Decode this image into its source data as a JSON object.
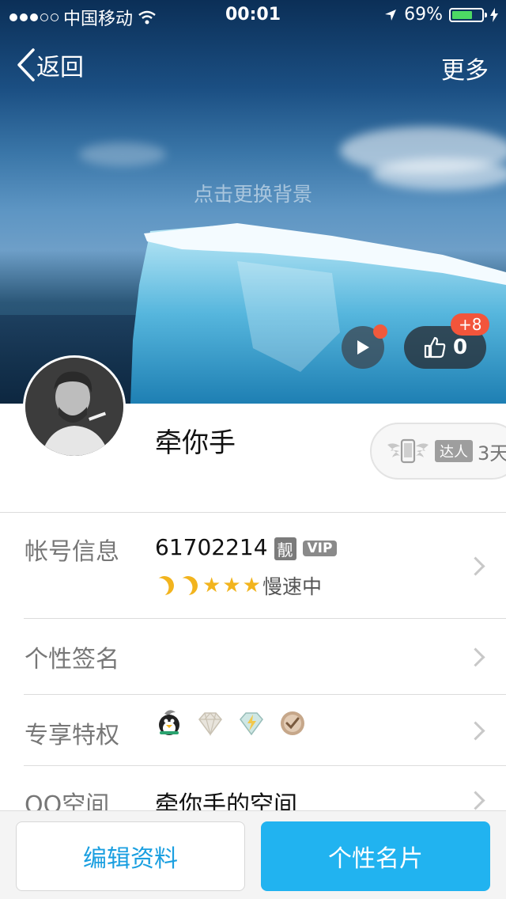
{
  "status_bar": {
    "carrier": "中国移动",
    "time": "00:01",
    "battery": "69%",
    "battery_level": 0.69
  },
  "nav": {
    "back_label": "返回",
    "more_label": "更多"
  },
  "cover": {
    "hint": "点击更换背景",
    "like_count": "0",
    "like_delta": "+8"
  },
  "profile": {
    "nickname": "牵你手",
    "daren_label": "达人",
    "daren_days": "3天"
  },
  "rows": {
    "account": {
      "label": "帐号信息",
      "qq_number": "61702214",
      "liang_badge": "靓",
      "vip_badge": "VIP",
      "level_status": "慢速中"
    },
    "signature": {
      "label": "个性签名"
    },
    "privileges": {
      "label": "专享特权",
      "icons": [
        "penguin-icon",
        "diamond-icon",
        "lightning-diamond-icon",
        "check-badge-icon"
      ]
    },
    "qzone": {
      "label": "QQ空间",
      "value": "牵你手的空间"
    }
  },
  "bottom": {
    "edit_label": "编辑资料",
    "card_label": "个性名片"
  },
  "colors": {
    "accent_blue": "#21b3f0",
    "link_blue": "#1a9fe0",
    "badge_red": "#f2553b",
    "star_gold": "#f2b41e"
  }
}
